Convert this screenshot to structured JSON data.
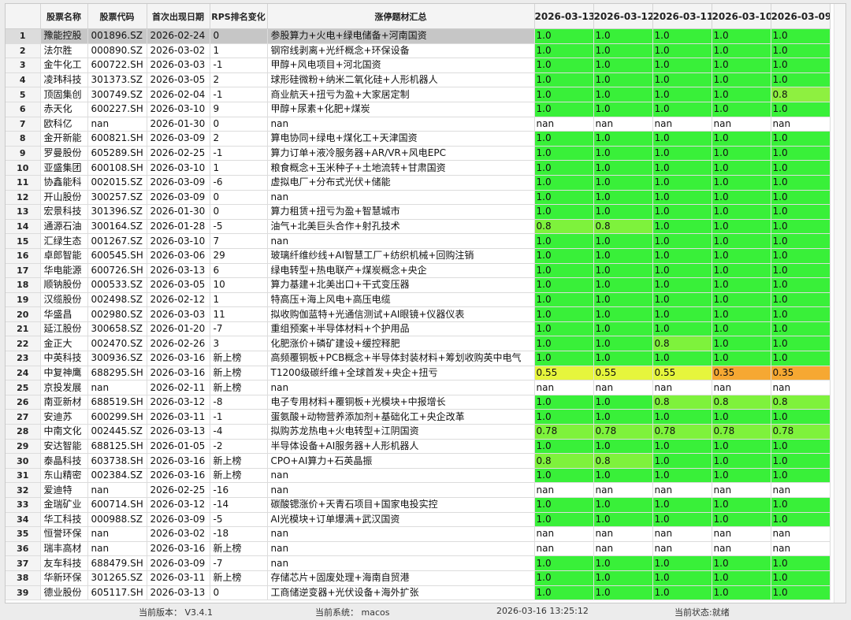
{
  "columns": [
    "",
    "股票名称",
    "股票代码",
    "首次出现日期",
    "RPS排名变化",
    "涨停题材汇总",
    "2026-03-13",
    "2026-03-12",
    "2026-03-11",
    "2026-03-10",
    "2026-03-09"
  ],
  "colors": {
    "green": "#39f039",
    "yellow": "#e6f53c",
    "orange": "#f6a832",
    "light_green": "#7cf24a",
    "lime": "#a9f24a"
  },
  "rows": [
    [
      "1",
      "豫能控股",
      "001896.SZ",
      "2026-02-24",
      "0",
      "参股算力+火电+绿电储备+河南国资",
      "1.0",
      "1.0",
      "1.0",
      "1.0",
      "1.0"
    ],
    [
      "2",
      "法尔胜",
      "000890.SZ",
      "2026-03-02",
      "1",
      "钢帘线剥离+光纤概念+环保设备",
      "1.0",
      "1.0",
      "1.0",
      "1.0",
      "1.0"
    ],
    [
      "3",
      "金牛化工",
      "600722.SH",
      "2026-03-03",
      "-1",
      "甲醇+风电项目+河北国资",
      "1.0",
      "1.0",
      "1.0",
      "1.0",
      "1.0"
    ],
    [
      "4",
      "凌玮科技",
      "301373.SZ",
      "2026-03-05",
      "2",
      "球形硅微粉+纳米二氧化硅+人形机器人",
      "1.0",
      "1.0",
      "1.0",
      "1.0",
      "1.0"
    ],
    [
      "5",
      "顶固集创",
      "300749.SZ",
      "2026-02-04",
      "-1",
      "商业航天+扭亏为盈+大家居定制",
      "1.0",
      "1.0",
      "1.0",
      "1.0",
      "0.8"
    ],
    [
      "6",
      "赤天化",
      "600227.SH",
      "2026-03-10",
      "9",
      "甲醇+尿素+化肥+煤炭",
      "1.0",
      "1.0",
      "1.0",
      "1.0",
      "1.0"
    ],
    [
      "7",
      "欧科亿",
      "nan",
      "2026-01-30",
      "0",
      "nan",
      "nan",
      "nan",
      "nan",
      "nan",
      "nan"
    ],
    [
      "8",
      "金开新能",
      "600821.SH",
      "2026-03-09",
      "2",
      "算电协同+绿电+煤化工+天津国资",
      "1.0",
      "1.0",
      "1.0",
      "1.0",
      "1.0"
    ],
    [
      "9",
      "罗曼股份",
      "605289.SH",
      "2026-02-25",
      "-1",
      "算力订单+液冷服务器+AR/VR+风电EPC",
      "1.0",
      "1.0",
      "1.0",
      "1.0",
      "1.0"
    ],
    [
      "10",
      "亚盛集团",
      "600108.SH",
      "2026-03-10",
      "1",
      "粮食概念+玉米种子+土地流转+甘肃国资",
      "1.0",
      "1.0",
      "1.0",
      "1.0",
      "1.0"
    ],
    [
      "11",
      "协鑫能科",
      "002015.SZ",
      "2026-03-09",
      "-6",
      "虚拟电厂+分布式光伏+储能",
      "1.0",
      "1.0",
      "1.0",
      "1.0",
      "1.0"
    ],
    [
      "12",
      "开山股份",
      "300257.SZ",
      "2026-03-09",
      "0",
      "nan",
      "1.0",
      "1.0",
      "1.0",
      "1.0",
      "1.0"
    ],
    [
      "13",
      "宏景科技",
      "301396.SZ",
      "2026-01-30",
      "0",
      "算力租赁+扭亏为盈+智慧城市",
      "1.0",
      "1.0",
      "1.0",
      "1.0",
      "1.0"
    ],
    [
      "14",
      "通源石油",
      "300164.SZ",
      "2026-01-28",
      "-5",
      "油气+北美巨头合作+射孔技术",
      "0.8",
      "0.8",
      "1.0",
      "1.0",
      "1.0"
    ],
    [
      "15",
      "汇绿生态",
      "001267.SZ",
      "2026-03-10",
      "7",
      "nan",
      "1.0",
      "1.0",
      "1.0",
      "1.0",
      "1.0"
    ],
    [
      "16",
      "卓郎智能",
      "600545.SH",
      "2026-03-06",
      "29",
      "玻璃纤维纱线+AI智慧工厂+纺织机械+回购注销",
      "1.0",
      "1.0",
      "1.0",
      "1.0",
      "1.0"
    ],
    [
      "17",
      "华电能源",
      "600726.SH",
      "2026-03-13",
      "6",
      "绿电转型+热电联产+煤炭概念+央企",
      "1.0",
      "1.0",
      "1.0",
      "1.0",
      "1.0"
    ],
    [
      "18",
      "顺钠股份",
      "000533.SZ",
      "2026-03-05",
      "10",
      "算力基建+北美出口+干式变压器",
      "1.0",
      "1.0",
      "1.0",
      "1.0",
      "1.0"
    ],
    [
      "19",
      "汉缆股份",
      "002498.SZ",
      "2026-02-12",
      "1",
      "特高压+海上风电+高压电缆",
      "1.0",
      "1.0",
      "1.0",
      "1.0",
      "1.0"
    ],
    [
      "20",
      "华盛昌",
      "002980.SZ",
      "2026-03-03",
      "11",
      "拟收购伽蓝特+光通信测试+AI眼镜+仪器仪表",
      "1.0",
      "1.0",
      "1.0",
      "1.0",
      "1.0"
    ],
    [
      "21",
      "延江股份",
      "300658.SZ",
      "2026-01-20",
      "-7",
      "重组预案+半导体材料+个护用品",
      "1.0",
      "1.0",
      "1.0",
      "1.0",
      "1.0"
    ],
    [
      "22",
      "金正大",
      "002470.SZ",
      "2026-02-26",
      "3",
      "化肥涨价+磷矿建设+缓控释肥",
      "1.0",
      "1.0",
      "0.8",
      "1.0",
      "1.0"
    ],
    [
      "23",
      "中英科技",
      "300936.SZ",
      "2026-03-16",
      "新上榜",
      "高频覆铜板+PCB概念+半导体封装材料+筹划收购英中电气",
      "1.0",
      "1.0",
      "1.0",
      "1.0",
      "1.0"
    ],
    [
      "24",
      "中复神鹰",
      "688295.SH",
      "2026-03-16",
      "新上榜",
      "T1200级碳纤维+全球首发+央企+扭亏",
      "0.55",
      "0.55",
      "0.55",
      "0.35",
      "0.35"
    ],
    [
      "25",
      "京投发展",
      "nan",
      "2026-02-11",
      "新上榜",
      "nan",
      "nan",
      "nan",
      "nan",
      "nan",
      "nan"
    ],
    [
      "26",
      "南亚新材",
      "688519.SH",
      "2026-03-12",
      "-8",
      "电子专用材料+覆铜板+光模块+中报增长",
      "1.0",
      "1.0",
      "0.8",
      "0.8",
      "0.8"
    ],
    [
      "27",
      "安迪苏",
      "600299.SH",
      "2026-03-11",
      "-1",
      "蛋氨酸+动物营养添加剂+基础化工+央企改革",
      "1.0",
      "1.0",
      "1.0",
      "1.0",
      "1.0"
    ],
    [
      "28",
      "中南文化",
      "002445.SZ",
      "2026-03-13",
      "-4",
      "拟购苏龙热电+火电转型+江阴国资",
      "0.78",
      "0.78",
      "0.78",
      "0.78",
      "0.78"
    ],
    [
      "29",
      "安达智能",
      "688125.SH",
      "2026-01-05",
      "-2",
      "半导体设备+AI服务器+人形机器人",
      "1.0",
      "1.0",
      "1.0",
      "1.0",
      "1.0"
    ],
    [
      "30",
      "泰晶科技",
      "603738.SH",
      "2026-03-16",
      "新上榜",
      "CPO+AI算力+石英晶振",
      "0.8",
      "0.8",
      "1.0",
      "1.0",
      "1.0"
    ],
    [
      "31",
      "东山精密",
      "002384.SZ",
      "2026-03-16",
      "新上榜",
      "nan",
      "1.0",
      "1.0",
      "1.0",
      "1.0",
      "1.0"
    ],
    [
      "32",
      "爱迪特",
      "nan",
      "2026-02-25",
      "-16",
      "nan",
      "nan",
      "nan",
      "nan",
      "nan",
      "nan"
    ],
    [
      "33",
      "金瑞矿业",
      "600714.SH",
      "2026-03-12",
      "-14",
      "碳酸锶涨价+天青石项目+国家电投实控",
      "1.0",
      "1.0",
      "1.0",
      "1.0",
      "1.0"
    ],
    [
      "34",
      "华工科技",
      "000988.SZ",
      "2026-03-09",
      "-5",
      "AI光模块+订单爆满+武汉国资",
      "1.0",
      "1.0",
      "1.0",
      "1.0",
      "1.0"
    ],
    [
      "35",
      "恒誉环保",
      "nan",
      "2026-03-02",
      "-18",
      "nan",
      "nan",
      "nan",
      "nan",
      "nan",
      "nan"
    ],
    [
      "36",
      "瑞丰高材",
      "nan",
      "2026-03-16",
      "新上榜",
      "nan",
      "nan",
      "nan",
      "nan",
      "nan",
      "nan"
    ],
    [
      "37",
      "友车科技",
      "688479.SH",
      "2026-03-09",
      "-7",
      "nan",
      "1.0",
      "1.0",
      "1.0",
      "1.0",
      "1.0"
    ],
    [
      "38",
      "华新环保",
      "301265.SZ",
      "2026-03-11",
      "新上榜",
      "存储芯片+固废处理+海南自贸港",
      "1.0",
      "1.0",
      "1.0",
      "1.0",
      "1.0"
    ],
    [
      "39",
      "德业股份",
      "605117.SH",
      "2026-03-13",
      "0",
      "工商储逆变器+光伏设备+海外扩张",
      "1.0",
      "1.0",
      "1.0",
      "1.0",
      "1.0"
    ]
  ],
  "status": {
    "version": "当前版本： V3.4.1",
    "system": "当前系统： macos",
    "datetime": "2026-03-16 13:25:12",
    "state": "当前状态:就绪"
  }
}
